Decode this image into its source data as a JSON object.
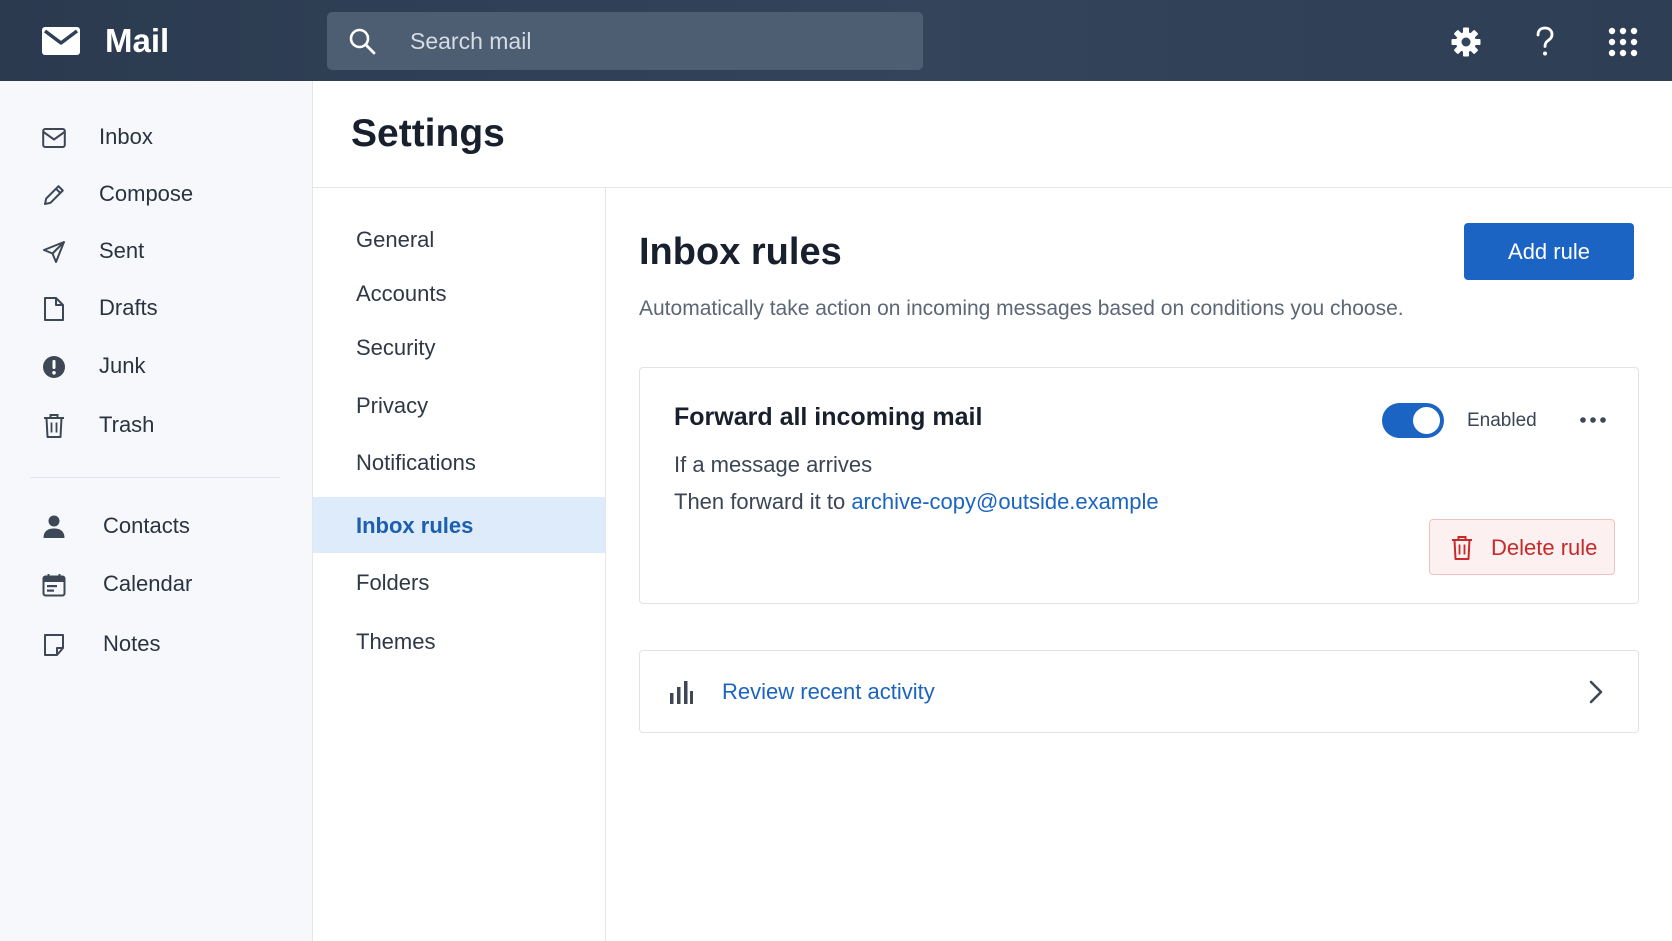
{
  "app": {
    "title": "Mail"
  },
  "search": {
    "placeholder": "Search mail"
  },
  "sidebar": {
    "items": [
      {
        "label": "Inbox",
        "icon": "inbox-icon"
      },
      {
        "label": "Compose",
        "icon": "pencil-icon"
      },
      {
        "label": "Sent",
        "icon": "send-icon"
      },
      {
        "label": "Drafts",
        "icon": "file-icon"
      },
      {
        "label": "Junk",
        "icon": "alert-icon"
      },
      {
        "label": "Trash",
        "icon": "trash-icon"
      },
      {
        "label": "Contacts",
        "icon": "person-icon"
      },
      {
        "label": "Calendar",
        "icon": "calendar-icon"
      },
      {
        "label": "Notes",
        "icon": "note-icon"
      }
    ]
  },
  "settings": {
    "title": "Settings",
    "nav": [
      {
        "label": "General"
      },
      {
        "label": "Accounts"
      },
      {
        "label": "Security"
      },
      {
        "label": "Privacy"
      },
      {
        "label": "Notifications"
      },
      {
        "label": "Inbox rules",
        "active": true
      },
      {
        "label": "Folders"
      },
      {
        "label": "Themes"
      }
    ]
  },
  "main": {
    "title": "Inbox rules",
    "description": "Automatically take action on incoming messages based on conditions you choose.",
    "add_button": "Add rule",
    "rule": {
      "name": "Forward all incoming mail",
      "condition": "If a message arrives",
      "action_prefix": "Then forward it to ",
      "action_target": "archive-copy@outside.example",
      "status": "Enabled",
      "enabled": true,
      "delete_label": "Delete rule"
    },
    "activity": {
      "label": "Review recent activity"
    }
  },
  "colors": {
    "topbar": "#2f3f55",
    "accent": "#1c64c4",
    "link": "#1b64bf",
    "danger": "#c72a2a",
    "active_nav_bg": "#deebfa"
  }
}
